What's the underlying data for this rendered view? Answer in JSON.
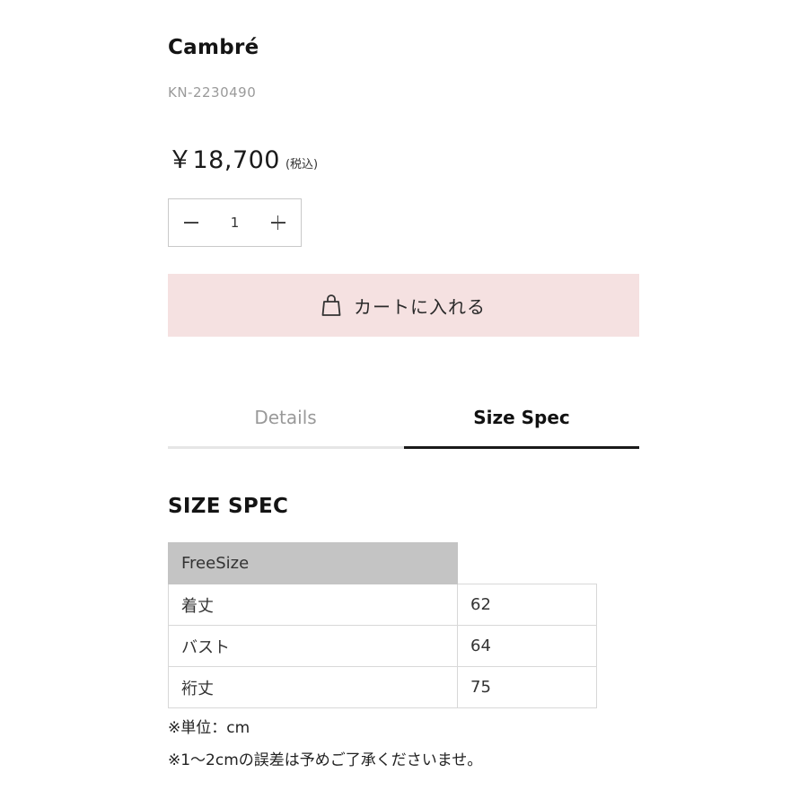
{
  "product": {
    "name": "Cambré",
    "code": "KN-2230490",
    "price": "￥18,700",
    "tax_note": "(税込)"
  },
  "quantity": {
    "value": "1",
    "decrease_icon": "minus-icon",
    "increase_icon": "plus-icon"
  },
  "cart": {
    "label": "カートに入れる",
    "icon": "shopping-bag-icon",
    "bg_color": "#f5e1e1"
  },
  "tabs": [
    {
      "label": "Details",
      "active": false
    },
    {
      "label": "Size Spec",
      "active": true
    }
  ],
  "size_spec": {
    "title": "SIZE SPEC",
    "header": "FreeSize",
    "rows": [
      {
        "label": "着丈",
        "value": "62"
      },
      {
        "label": "バスト",
        "value": "64"
      },
      {
        "label": "裄丈",
        "value": "75"
      }
    ],
    "notes": [
      "※単位：cm",
      "※1〜2cmの誤差は予めご了承くださいませ。"
    ]
  }
}
